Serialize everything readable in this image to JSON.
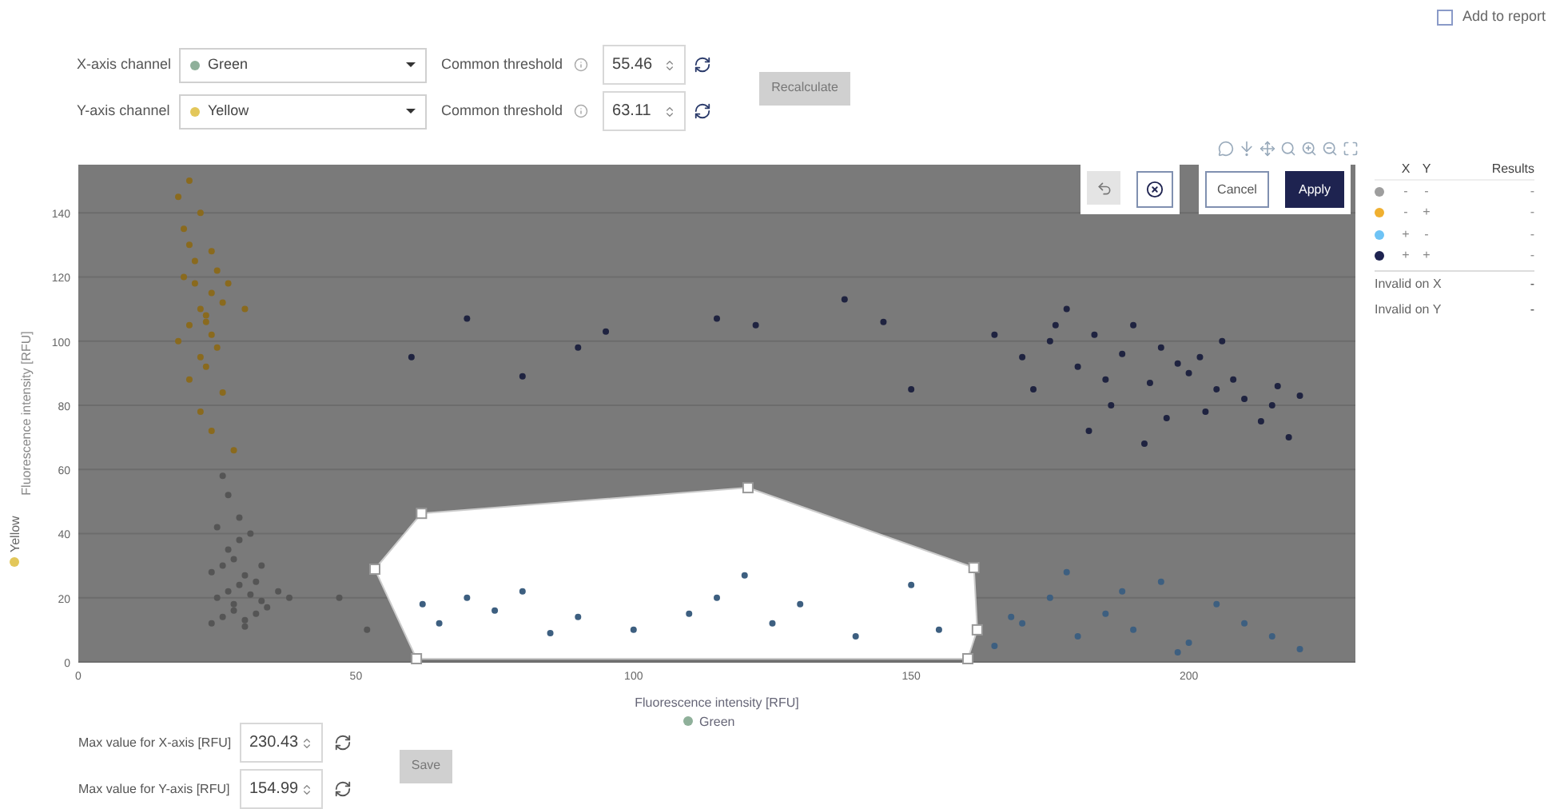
{
  "report": {
    "label": "Add to report",
    "checked": false
  },
  "channels": [
    {
      "label": "X-axis channel",
      "value": "Green",
      "color": "#8fb09a",
      "threshold_label": "Common threshold",
      "threshold": "55.46"
    },
    {
      "label": "Y-axis channel",
      "value": "Yellow",
      "color": "#e3c75a",
      "threshold_label": "Common threshold",
      "threshold": "63.11"
    }
  ],
  "recalculate": {
    "label": "Recalculate",
    "disabled": true
  },
  "gate_actions": {
    "cancel": "Cancel",
    "apply": "Apply"
  },
  "chart": {
    "x_channel": {
      "label": "Green",
      "color": "#8fb09a"
    },
    "y_channel": {
      "label": "Yellow",
      "color": "#e3c75a"
    },
    "chart_data": {
      "type": "scatter",
      "grid": true,
      "xlabel": "Fluorescence intensity [RFU]",
      "ylabel": "Fluorescence intensity [RFU]",
      "xlim": [
        0,
        230
      ],
      "ylim": [
        0,
        155
      ],
      "xticks": [
        0,
        50,
        100,
        150,
        200
      ],
      "yticks": [
        0,
        20,
        40,
        60,
        80,
        100,
        120,
        140
      ],
      "series": [
        {
          "color": "#555555",
          "x": [
            24,
            26,
            28,
            30,
            32,
            25,
            27,
            29,
            31,
            33,
            24,
            26,
            28,
            30,
            27,
            29,
            31,
            25,
            28,
            30,
            32,
            34,
            36,
            29,
            27,
            26,
            33,
            38,
            47,
            52
          ],
          "values": [
            12,
            14,
            16,
            13,
            15,
            20,
            22,
            24,
            21,
            19,
            28,
            30,
            32,
            27,
            35,
            38,
            40,
            42,
            18,
            11,
            25,
            17,
            22,
            45,
            52,
            58,
            30,
            20,
            20,
            10
          ]
        },
        {
          "color": "#8a6a1e",
          "x": [
            18,
            20,
            22,
            24,
            19,
            21,
            23,
            25,
            20,
            22,
            24,
            26,
            21,
            23,
            19,
            22,
            24,
            20,
            23,
            25,
            18,
            27,
            26,
            22,
            20,
            24,
            28,
            30
          ],
          "values": [
            100,
            105,
            110,
            115,
            120,
            125,
            108,
            98,
            130,
            95,
            102,
            112,
            118,
            92,
            135,
            140,
            128,
            88,
            106,
            122,
            145,
            118,
            84,
            78,
            150,
            72,
            66,
            110
          ]
        },
        {
          "color": "#1f2340",
          "x": [
            170,
            175,
            180,
            185,
            190,
            195,
            200,
            205,
            210,
            215,
            172,
            178,
            183,
            188,
            193,
            198,
            203,
            208,
            213,
            218,
            176,
            186,
            196,
            206,
            216,
            182,
            192,
            202,
            60,
            70,
            80,
            90,
            95,
            115,
            122,
            138,
            145,
            150,
            165,
            220
          ],
          "values": [
            95,
            100,
            92,
            88,
            105,
            98,
            90,
            85,
            82,
            80,
            85,
            110,
            102,
            96,
            87,
            93,
            78,
            88,
            75,
            70,
            105,
            80,
            76,
            100,
            86,
            72,
            68,
            95,
            95,
            107,
            89,
            98,
            103,
            107,
            105,
            113,
            106,
            85,
            102,
            83
          ]
        },
        {
          "color": "#3d5f80",
          "x": [
            62,
            65,
            70,
            75,
            80,
            85,
            90,
            100,
            110,
            115,
            120,
            125,
            130,
            140,
            150,
            155,
            165,
            170,
            175,
            180,
            185,
            190,
            195,
            200,
            205,
            210,
            215,
            220,
            178,
            188,
            198,
            168
          ],
          "values": [
            18,
            12,
            20,
            16,
            22,
            9,
            14,
            10,
            15,
            20,
            27,
            12,
            18,
            8,
            24,
            10,
            5,
            12,
            20,
            8,
            15,
            10,
            25,
            6,
            18,
            12,
            8,
            4,
            28,
            22,
            3,
            14
          ]
        }
      ]
    }
  },
  "legend": {
    "columns": [
      "X",
      "Y",
      "Results"
    ],
    "rows": [
      {
        "color": "#9e9e9e",
        "x": "-",
        "y": "-",
        "result": "-"
      },
      {
        "color": "#f0b030",
        "x": "-",
        "y": "+",
        "result": "-"
      },
      {
        "color": "#6ec3f5",
        "x": "+",
        "y": "-",
        "result": "-"
      },
      {
        "color": "#1e2350",
        "x": "+",
        "y": "+",
        "result": "-"
      }
    ],
    "invalid": [
      {
        "label": "Invalid on X",
        "value": "-"
      },
      {
        "label": "Invalid on Y",
        "value": "-"
      }
    ]
  },
  "max_values": [
    {
      "label": "Max value for X-axis [RFU]",
      "value": "230.43"
    },
    {
      "label": "Max value for Y-axis [RFU]",
      "value": "154.99"
    }
  ],
  "save": {
    "label": "Save",
    "disabled": true
  }
}
